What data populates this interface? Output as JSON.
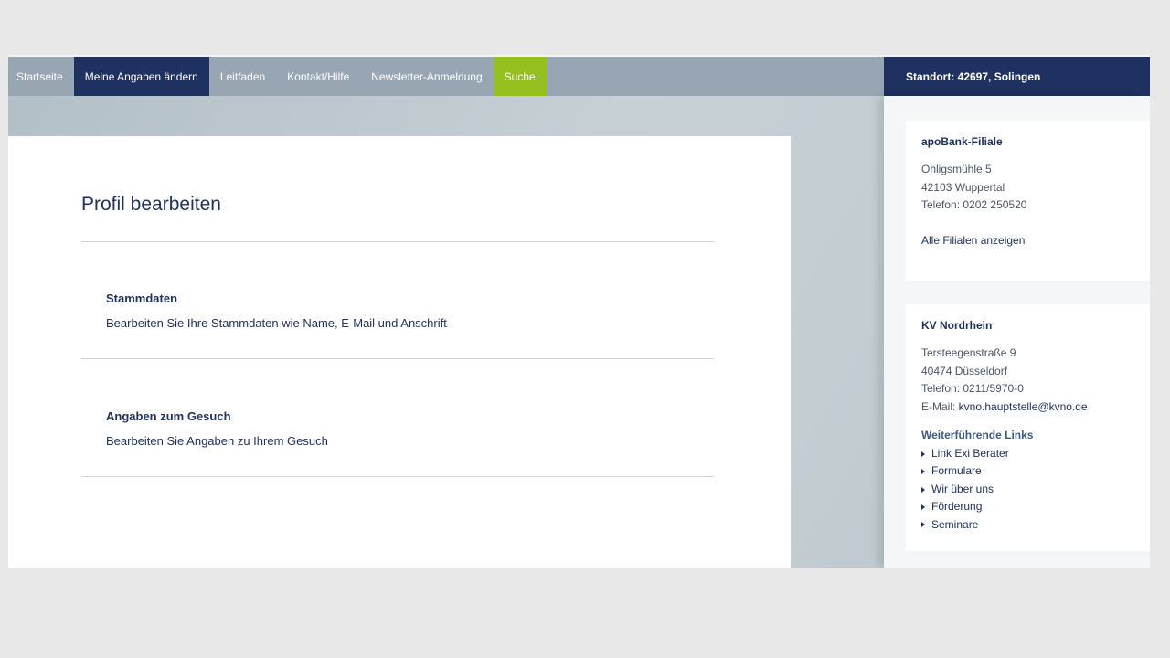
{
  "nav": {
    "items": [
      {
        "label": "Startseite"
      },
      {
        "label": "Meine Angaben ändern"
      },
      {
        "label": "Leitfaden"
      },
      {
        "label": "Kontakt/Hilfe"
      },
      {
        "label": "Newsletter-Anmeldung"
      },
      {
        "label": "Suche"
      }
    ]
  },
  "standort": "Standort: 42697, Solingen",
  "main": {
    "title": "Profil bearbeiten",
    "sections": [
      {
        "heading": "Stammdaten",
        "description": "Bearbeiten Sie Ihre Stammdaten wie Name, E-Mail und Anschrift"
      },
      {
        "heading": "Angaben zum Gesuch",
        "description": "Bearbeiten Sie Angaben zu Ihrem Gesuch"
      }
    ]
  },
  "sidebar": {
    "bank": {
      "title": "apoBank-Filiale",
      "street": "Ohligsmühle 5",
      "city": "42103 Wuppertal",
      "phone": "Telefon: 0202 250520",
      "all_link": "Alle Filialen anzeigen"
    },
    "kv": {
      "title": "KV Nordrhein",
      "street": "Tersteegenstraße 9",
      "city": "40474 Düsseldorf",
      "phone": "Telefon: 0211/5970-0",
      "email_label": "E-Mail: ",
      "email": "kvno.hauptstelle@kvno.de",
      "links_title": "Weiterführende Links",
      "links": [
        {
          "label": "Link Exi Berater"
        },
        {
          "label": "Formulare"
        },
        {
          "label": "Wir über uns"
        },
        {
          "label": "Förderung"
        },
        {
          "label": "Seminare"
        }
      ]
    }
  },
  "colors": {
    "navy": "#1f3160",
    "accent_green": "#95bf1f",
    "nav_grey": "#98a6b3"
  }
}
